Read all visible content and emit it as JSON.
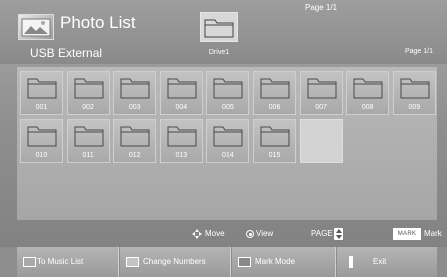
{
  "header": {
    "title": "Photo List",
    "icon": "photo-icon",
    "source": "USB External",
    "page_top": "Page 1/1",
    "page_right": "Page 1/1",
    "drive": {
      "label": "Drive1",
      "icon": "folder-icon"
    }
  },
  "folders": [
    {
      "label": "001"
    },
    {
      "label": "002"
    },
    {
      "label": "003"
    },
    {
      "label": "004"
    },
    {
      "label": "005"
    },
    {
      "label": "006"
    },
    {
      "label": "007"
    },
    {
      "label": "008"
    },
    {
      "label": "009"
    },
    {
      "label": "010"
    },
    {
      "label": "011"
    },
    {
      "label": "012"
    },
    {
      "label": "013"
    },
    {
      "label": "014"
    },
    {
      "label": "015"
    }
  ],
  "help": {
    "move": "Move",
    "view": "View",
    "page": "PAGE",
    "mark_key": "MARK",
    "mark": "Mark"
  },
  "buttons": [
    {
      "label": "To Music List",
      "color": "#a9a9a9"
    },
    {
      "label": "Change Numbers",
      "color": "#c4c4c4"
    },
    {
      "label": "Mark Mode",
      "color": "#8a8a8a"
    },
    {
      "label": "Exit",
      "color": "#ffffff"
    }
  ]
}
